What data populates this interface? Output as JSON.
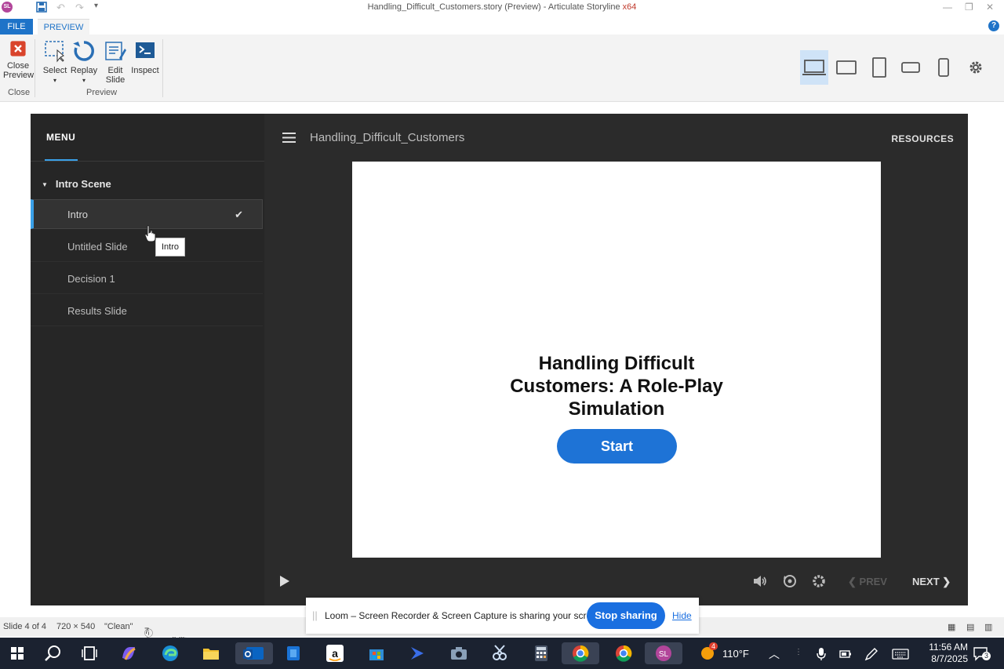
{
  "window": {
    "app_logo": "SL",
    "title": "Handling_Difficult_Customers.story (Preview) - Articulate Storyline",
    "arch": "x64"
  },
  "ribbon_tabs": {
    "file": "FILE",
    "preview": "PREVIEW"
  },
  "ribbon": {
    "close_preview_line1": "Close",
    "close_preview_line2": "Preview",
    "close_group": "Close",
    "select": "Select",
    "replay": "Replay",
    "edit_slide_line1": "Edit",
    "edit_slide_line2": "Slide",
    "inspect": "Inspect",
    "preview_group": "Preview"
  },
  "player": {
    "menu_label": "MENU",
    "scene": "Intro Scene",
    "slides": [
      {
        "label": "Intro",
        "active": true
      },
      {
        "label": "Untitled Slide"
      },
      {
        "label": "Decision 1"
      },
      {
        "label": "Results Slide"
      }
    ],
    "course_title": "Handling_Difficult_Customers",
    "resources": "RESOURCES",
    "prev": "PREV",
    "next": "NEXT"
  },
  "slide": {
    "title_line1": "Handling Difficult",
    "title_line2": "Customers: A Role-Play",
    "title_line3": "Simulation",
    "start_button": "Start"
  },
  "tooltip": "Intro",
  "statusbar": {
    "slide_pos": "Slide 4 of 4",
    "dimensions": "720 × 540",
    "theme": "\"Clean\"",
    "accessibility": "7 Accessibility Issues"
  },
  "loom": {
    "message": "Loom – Screen Recorder & Screen Capture is sharing your screen.",
    "stop": "Stop sharing",
    "hide": "Hide"
  },
  "taskbar": {
    "weather_badge": "4",
    "temperature": "110°F",
    "time": "11:56 AM",
    "date": "8/7/2025",
    "notifications": "3"
  },
  "colors": {
    "accent_blue": "#1e73c8",
    "player_bg": "#2b2b2b",
    "start_button": "#1e73d6",
    "active_indicator": "#3aa0e8"
  }
}
